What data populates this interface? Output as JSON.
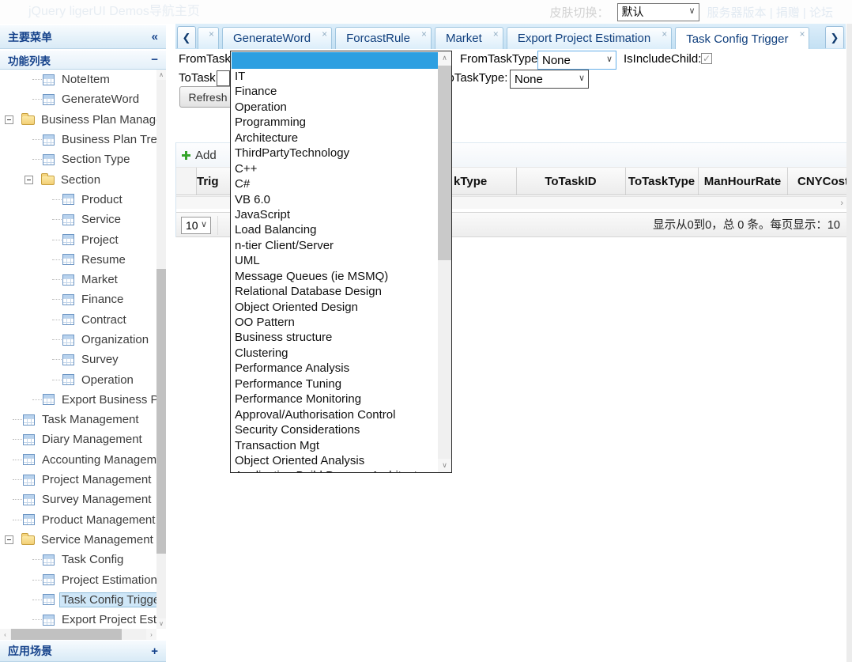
{
  "colors": {
    "accent_blue": "#2d9fe1",
    "header_text": "#15428b",
    "tabstrip_bg": "#cfe6f7"
  },
  "icons": {
    "collapse": "«",
    "minimize": "−",
    "expand_plus": "+",
    "tab_prev": "❮",
    "tab_next": "❯",
    "close": "×",
    "chevron_down": "∨",
    "scroll_up": "∧",
    "scroll_down": "∨",
    "scroll_left": "‹",
    "scroll_right": "›",
    "check": "✓"
  },
  "topbar": {
    "title": "jQuery ligerUI Demos导航主页",
    "skin_label": "皮肤切换：",
    "skin_value": "默认",
    "links": "服务器版本 | 捐赠 | 论坛"
  },
  "sidebar": {
    "main_menu_title": "主要菜单",
    "panel_title": "功能列表",
    "bottom_panel_title": "应用场景",
    "tree": [
      {
        "label": "NoteItem",
        "icon": "table",
        "level": 2
      },
      {
        "label": "GenerateWord",
        "icon": "table",
        "level": 2
      },
      {
        "label": "Business Plan Management",
        "icon": "folder",
        "level": 1,
        "expander": true
      },
      {
        "label": "Business Plan Tree",
        "icon": "table",
        "level": 2
      },
      {
        "label": "Section Type",
        "icon": "table",
        "level": 2
      },
      {
        "label": "Section",
        "icon": "folder",
        "level": 2,
        "expander": true
      },
      {
        "label": "Product",
        "icon": "table",
        "level": 3
      },
      {
        "label": "Service",
        "icon": "table",
        "level": 3
      },
      {
        "label": "Project",
        "icon": "table",
        "level": 3
      },
      {
        "label": "Resume",
        "icon": "table",
        "level": 3
      },
      {
        "label": "Market",
        "icon": "table",
        "level": 3
      },
      {
        "label": "Finance",
        "icon": "table",
        "level": 3
      },
      {
        "label": "Contract",
        "icon": "table",
        "level": 3
      },
      {
        "label": "Organization",
        "icon": "table",
        "level": 3
      },
      {
        "label": "Survey",
        "icon": "table",
        "level": 3
      },
      {
        "label": "Operation",
        "icon": "table",
        "level": 3
      },
      {
        "label": "Export Business Plan",
        "icon": "table",
        "level": 2
      },
      {
        "label": "Task Management",
        "icon": "table",
        "level": 1
      },
      {
        "label": "Diary Management",
        "icon": "table",
        "level": 1
      },
      {
        "label": "Accounting Management",
        "icon": "table",
        "level": 1
      },
      {
        "label": "Project Management",
        "icon": "table",
        "level": 1
      },
      {
        "label": "Survey Management",
        "icon": "table",
        "level": 1
      },
      {
        "label": "Product Management",
        "icon": "table",
        "level": 1
      },
      {
        "label": "Service Management",
        "icon": "folder",
        "level": 1,
        "expander": true
      },
      {
        "label": "Task Config",
        "icon": "table",
        "level": 2
      },
      {
        "label": "Project Estimation",
        "icon": "table",
        "level": 2
      },
      {
        "label": "Task Config Trigger",
        "icon": "table",
        "level": 2,
        "selected": true
      },
      {
        "label": "Export Project Estimation",
        "icon": "table",
        "level": 2
      }
    ]
  },
  "tabs": {
    "items": [
      {
        "label": "",
        "partial": true
      },
      {
        "label": "GenerateWord"
      },
      {
        "label": "ForcastRule"
      },
      {
        "label": "Market"
      },
      {
        "label": "Export Project Estimation"
      },
      {
        "label": "Task Config Trigger",
        "active": true
      }
    ]
  },
  "form": {
    "from_task_label": "FromTask:",
    "to_task_label": "ToTask:",
    "to_task_value": "",
    "from_task_type_label": "FromTaskType:",
    "from_task_type_value": "None",
    "to_task_type_label": "ToTaskType:",
    "to_task_type_value": "None",
    "is_include_child_label": "IsIncludeChild:",
    "is_include_child_checked": true,
    "refresh_label": "Refresh"
  },
  "dropdown": {
    "selected_index": 0,
    "items": [
      "",
      "IT",
      "Finance",
      "Operation",
      "Programming",
      "Architecture",
      "ThirdPartyTechnology",
      "C++",
      "C#",
      "VB 6.0",
      "JavaScript",
      "Load Balancing",
      "n-tier Client/Server",
      "UML",
      "Message Queues (ie MSMQ)",
      "Relational Database Design",
      "Object Oriented Design",
      "OO Pattern",
      "Business structure",
      "Clustering",
      "Performance Analysis",
      "Performance Tuning",
      "Performance Monitoring",
      "Approval/Authorisation Control",
      "Security Considerations",
      "Transaction Mgt",
      "Object Oriented Analysis",
      "Application Build Process Architecture"
    ]
  },
  "grid": {
    "toolbar": {
      "add_label": "Add"
    },
    "columns": [
      "Trig",
      "kType",
      "ToTaskID",
      "ToTaskType",
      "ManHourRate",
      "CNYCostI"
    ],
    "pagination": {
      "page_size": "10",
      "summary": "显示从0到0，总 0 条。每页显示：10"
    }
  }
}
